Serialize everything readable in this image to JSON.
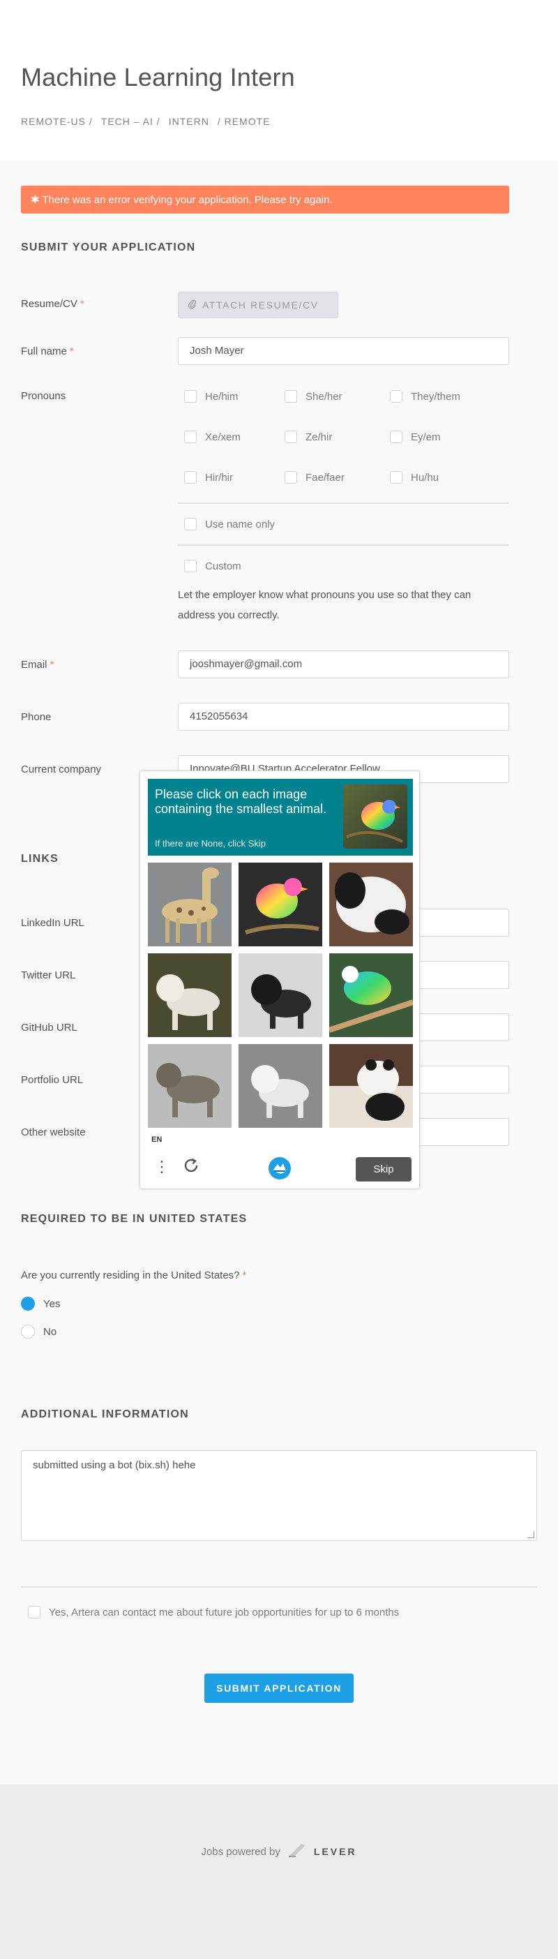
{
  "job": {
    "title": "Machine Learning Intern",
    "categories": [
      "REMOTE-US /",
      "TECH – AI /",
      "INTERN",
      "/ REMOTE"
    ]
  },
  "error": {
    "message": "✱ There was an error verifying your application. Please try again."
  },
  "sections": {
    "submit": "SUBMIT YOUR APPLICATION",
    "links": "LINKS",
    "us_required": "REQUIRED TO BE IN UNITED STATES",
    "additional": "ADDITIONAL INFORMATION"
  },
  "form": {
    "resume_label": "Resume/CV",
    "attach_label": "ATTACH RESUME/CV",
    "name_label": "Full name",
    "name_value": "Josh Mayer",
    "pronouns_label": "Pronouns",
    "pronouns": [
      "He/him",
      "She/her",
      "They/them",
      "Xe/xem",
      "Ze/hir",
      "Ey/em",
      "Hir/hir",
      "Fae/faer",
      "Hu/hu"
    ],
    "pronoun_name_only": "Use name only",
    "pronoun_custom": "Custom",
    "pronouns_help": "Let the employer know what pronouns you use so that they can address you correctly.",
    "email_label": "Email",
    "email_value": "jooshmayer@gmail.com",
    "phone_label": "Phone",
    "phone_value": "4152055634",
    "company_label": "Current company",
    "company_value": "Innovate@BU Startup Accelerator Fellow",
    "required_mark": "*"
  },
  "links": {
    "linkedin": "LinkedIn URL",
    "twitter": "Twitter URL",
    "github": "GitHub URL",
    "portfolio": "Portfolio URL",
    "other": "Other website"
  },
  "residency": {
    "question": "Are you currently residing in the United States?",
    "yes": "Yes",
    "no": "No",
    "selected": "Yes"
  },
  "additional": {
    "text": "submitted using a bot (bix.sh) hehe"
  },
  "consent": {
    "label": "Yes, Artera can contact me about future job opportunities for up to 6 months"
  },
  "submit": {
    "label": "SUBMIT APPLICATION"
  },
  "footer": {
    "powered_by": "Jobs powered by",
    "brand": "LEVER"
  },
  "captcha": {
    "prompt": "Please click on each image containing the smallest animal.",
    "skip_hint": "If there are None, click Skip",
    "language": "EN",
    "skip_label": "Skip",
    "tiles": [
      "giraffe",
      "bird",
      "panda",
      "lion",
      "lion",
      "bird",
      "lion",
      "lion",
      "panda"
    ]
  },
  "colors": {
    "error": "#ff835c",
    "accent": "#1ea0e6",
    "captcha_header": "#00838f"
  }
}
